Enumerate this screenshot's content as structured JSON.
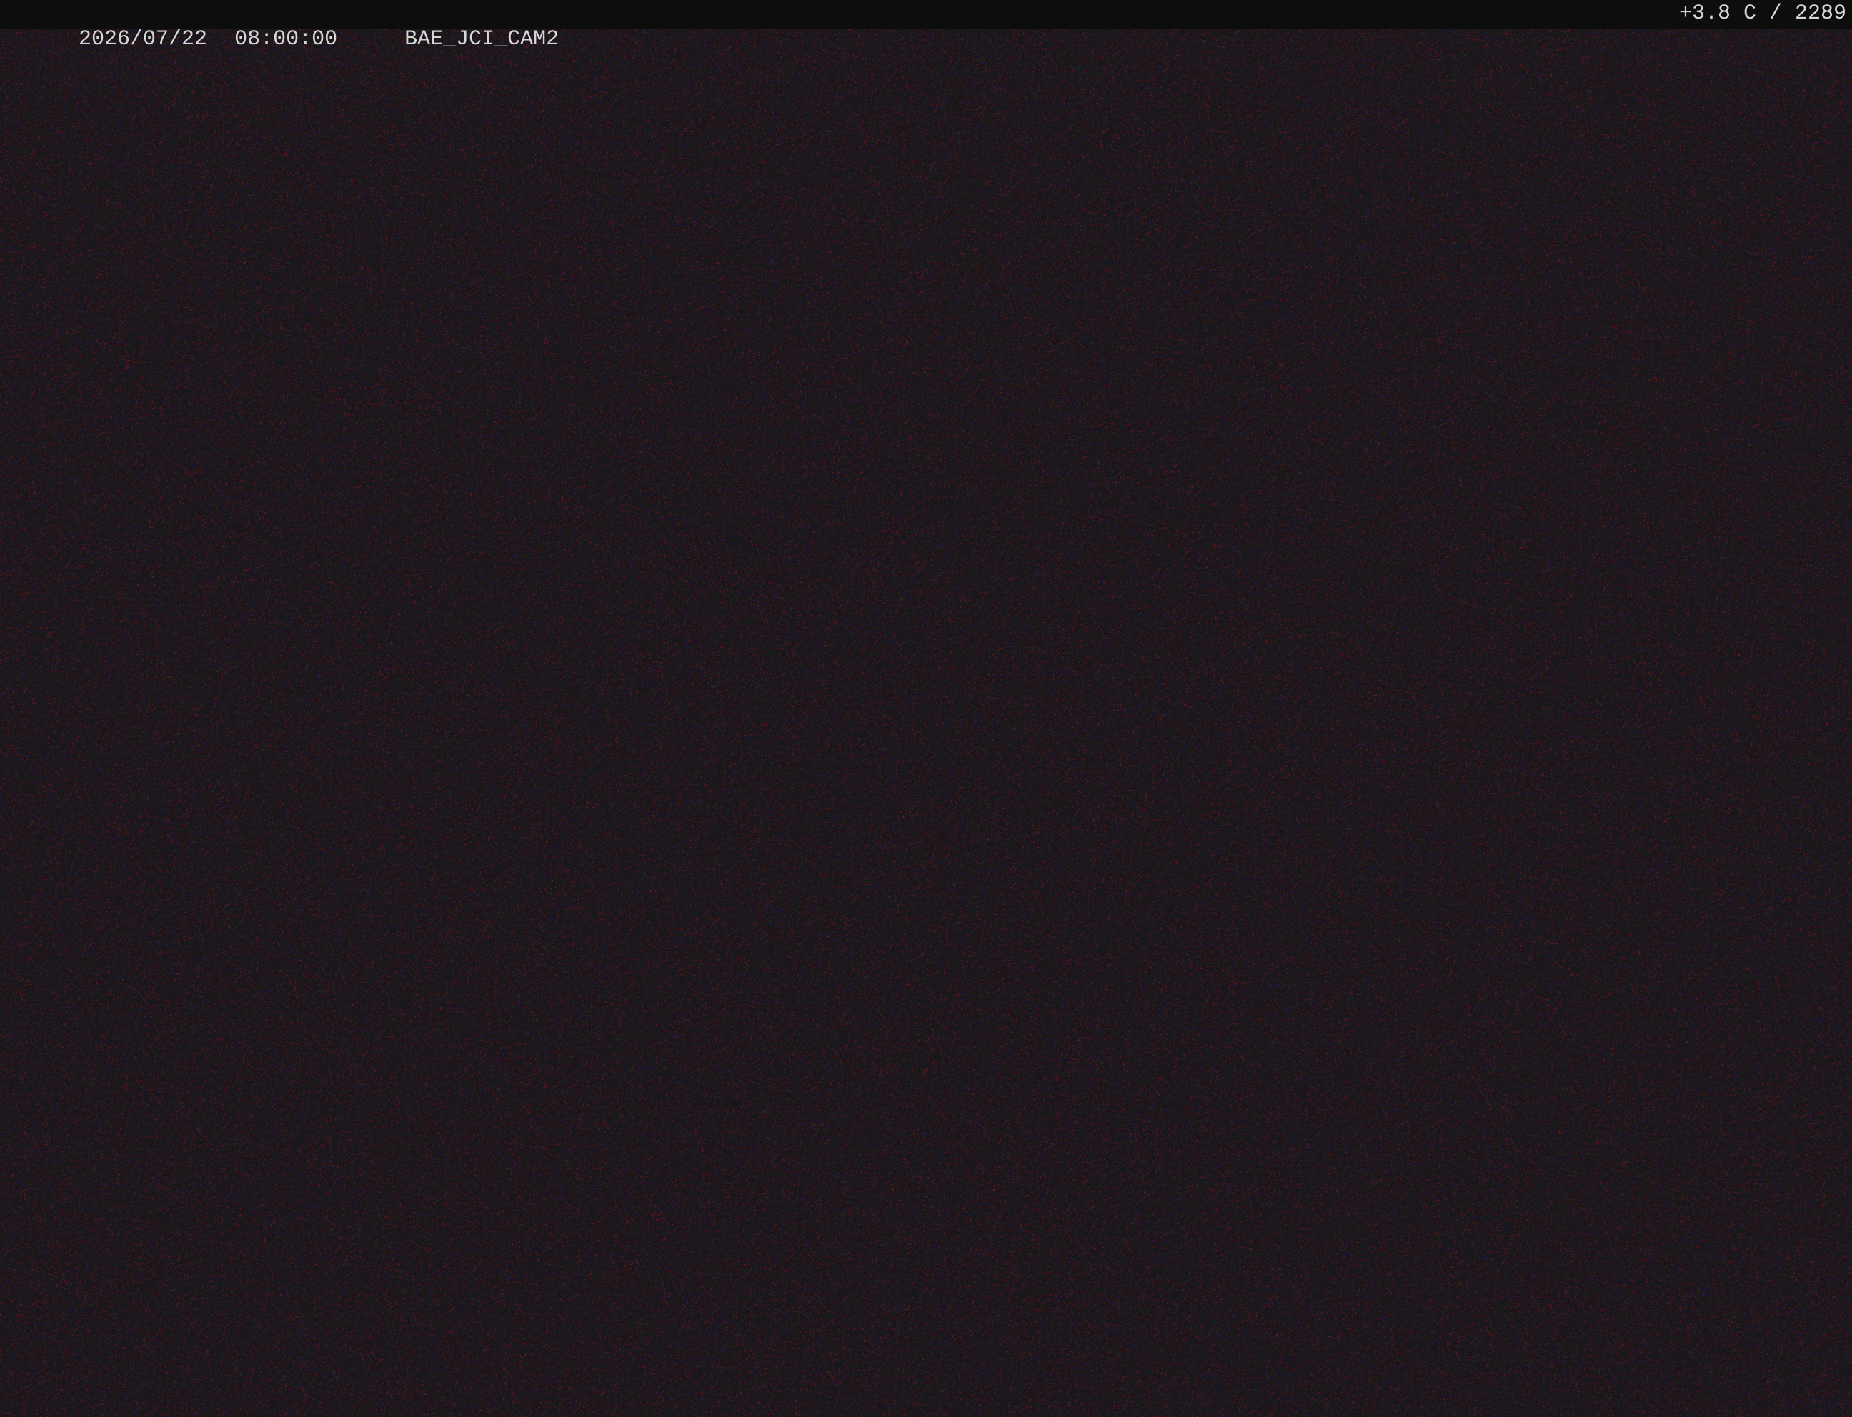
{
  "overlay": {
    "date": "2026/07/22",
    "time": "08:00:00",
    "camera_id": "BAE_JCI_CAM2",
    "readout": "+3.8 C / 2289"
  },
  "scene": {
    "description_colors": {
      "base": "#171417",
      "noise_red": "#7a1a22",
      "noise_blue": "#2a2270",
      "bar": "#0d0d0d",
      "text": "#d6d6d6"
    }
  }
}
